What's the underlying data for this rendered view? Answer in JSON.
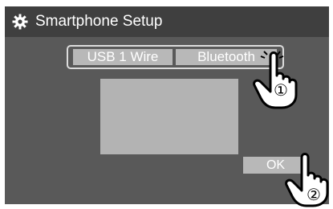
{
  "window": {
    "title": "Smartphone Setup",
    "icon": "gear-icon"
  },
  "tabs": [
    {
      "label": "USB 1 Wire"
    },
    {
      "label": "Bluetooth"
    }
  ],
  "actions": {
    "ok_label": "OK"
  },
  "callouts": [
    {
      "marker": "①",
      "icon": "touch-hand-icon"
    },
    {
      "marker": "②",
      "icon": "touch-hand-icon"
    }
  ],
  "colors": {
    "screen_bg": "#595959",
    "titlebar_bg": "#3f3f3f",
    "button_bg": "#b8b8b8",
    "preview_bg": "#b3b3b3",
    "text": "#ffffff"
  }
}
